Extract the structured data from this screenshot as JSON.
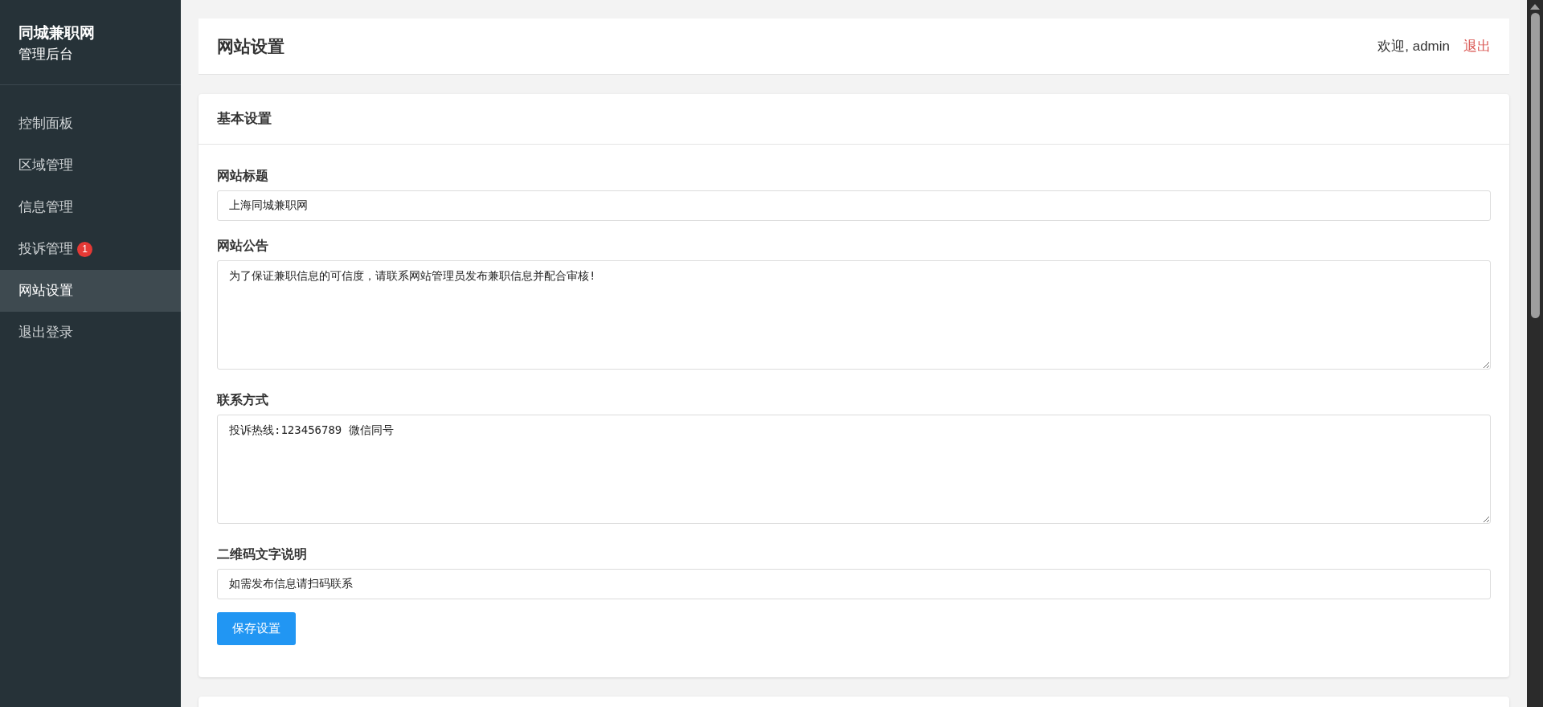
{
  "sidebar": {
    "brand": "同城兼职网",
    "subtitle": "管理后台",
    "items": [
      {
        "label": "控制面板",
        "selected": false
      },
      {
        "label": "区域管理",
        "selected": false
      },
      {
        "label": "信息管理",
        "selected": false
      },
      {
        "label": "投诉管理",
        "selected": false,
        "badge": "1"
      },
      {
        "label": "网站设置",
        "selected": true
      },
      {
        "label": "退出登录",
        "selected": false
      }
    ]
  },
  "header": {
    "title": "网站设置",
    "welcome": "欢迎, admin",
    "logout": "退出"
  },
  "settings_card": {
    "title": "基本设置",
    "fields": [
      {
        "kind": "input",
        "label": "网站标题",
        "value": "上海同城兼职网"
      },
      {
        "kind": "textarea",
        "label": "网站公告",
        "value": "为了保证兼职信息的可信度，请联系网站管理员发布兼职信息并配合审核!"
      },
      {
        "kind": "textarea",
        "label": "联系方式",
        "value": "投诉热线:123456789 微信同号"
      },
      {
        "kind": "input",
        "label": "二维码文字说明",
        "value": "如需发布信息请扫码联系"
      }
    ],
    "save_button": "保存设置"
  }
}
